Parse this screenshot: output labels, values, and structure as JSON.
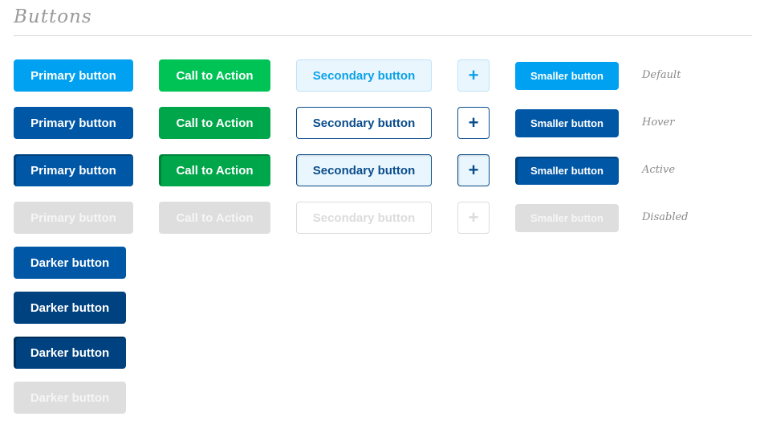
{
  "heading": "Buttons",
  "labels": {
    "primary": "Primary button",
    "cta": "Call to Action",
    "secondary": "Secondary button",
    "icon": "+",
    "small": "Smaller button",
    "darker": "Darker button"
  },
  "states": [
    "Default",
    "Hover",
    "Active",
    "Disabled"
  ],
  "colors": {
    "primary": "#00a1f0",
    "primary_dark": "#0057a6",
    "cta": "#00c356",
    "cta_dark": "#00a64a",
    "darker_hover": "#00427f",
    "disabled": "#dedede"
  }
}
